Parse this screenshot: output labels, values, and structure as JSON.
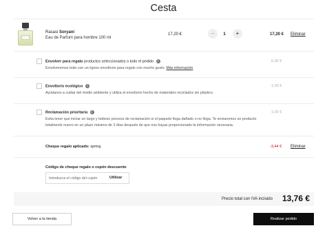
{
  "page": {
    "title": "Cesta"
  },
  "product": {
    "brand": "Rasasi",
    "name": "Soryani",
    "description": "Eau de Parfum para hombre 100 ml",
    "unit_price": "17,20 €",
    "quantity": "1",
    "line_total": "17,20 €",
    "remove_label": "Eliminar",
    "minus_label": "−",
    "plus_label": "+"
  },
  "options": [
    {
      "title_bold": "Envolver para regalo",
      "title_rest": "productos seleccionados o todo el pedido",
      "description": "Envolveremos todo con un lujoso envoltorio para regalo con mucho gusto.",
      "link": "Más información",
      "price": "6,00 €",
      "info_icon": "info-icon"
    },
    {
      "title_bold": "Envoltorio ecológico",
      "title_rest": "",
      "description": "Ayúdanos a cuidar del medio ambiente y utiliza el envoltorio hecho de materiales reciclados sin plástico.",
      "link": "",
      "price": "1,00 €",
      "info_icon": "info-icon"
    },
    {
      "title_bold": "Reclamación prioritaria",
      "title_rest": "",
      "description": "Evita tener que iniciar un largo y tedioso proceso de reclamación si el paquete llega dañado o no llega. Te enviaremos un producto totalmente nuevo en un plazo máximo de 3 días después de que nos hayas proporcionado la información necesaria.",
      "link": "",
      "price": "1,00 €",
      "info_icon": "info-icon"
    }
  ],
  "coupon": {
    "applied_label": "Cheque regalo aplicado:",
    "applied_code": "spring",
    "discount": "-3,44 €",
    "remove_label": "Eliminar",
    "heading": "Código de cheque regalo o cupón descuento",
    "placeholder": "Introduzca el código del cupón",
    "apply_label": "Utilizar"
  },
  "summary": {
    "total_label": "Precio total con IVA incluido",
    "total_value": "13,76 €"
  },
  "actions": {
    "back_label": "Volver a la tienda",
    "order_label": "Realizar pedido"
  },
  "colors": {
    "discount": "#d0021b",
    "primary_button": "#0d0d0d",
    "total_bar": "#f6f6f6"
  }
}
